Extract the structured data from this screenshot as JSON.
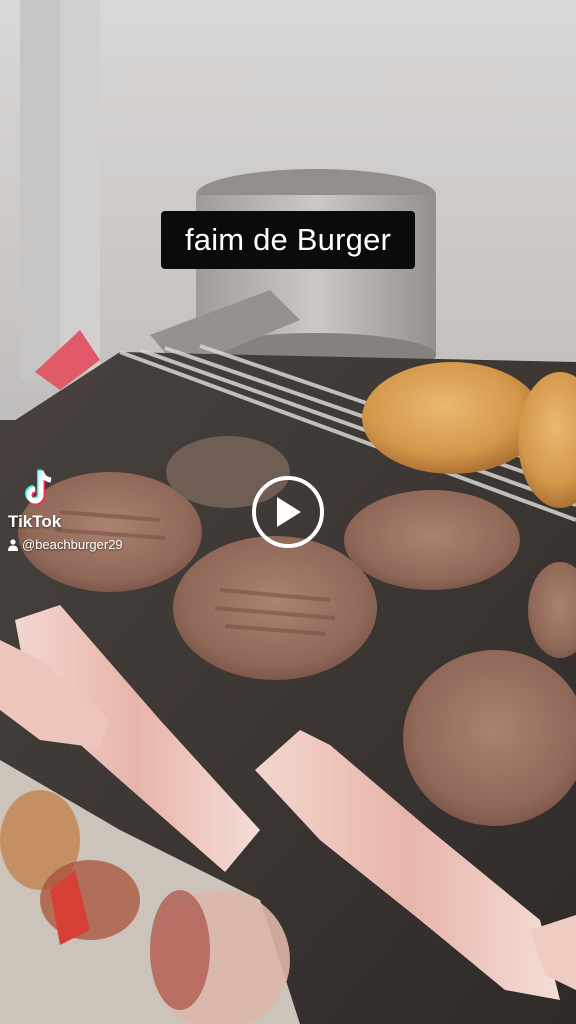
{
  "video": {
    "caption": "faim de Burger",
    "play_icon": "play-icon"
  },
  "watermark": {
    "brand": "TikTok",
    "handle": "@beachburger29",
    "logo_icon": "tiktok-logo-icon",
    "user_icon": "user-icon"
  }
}
